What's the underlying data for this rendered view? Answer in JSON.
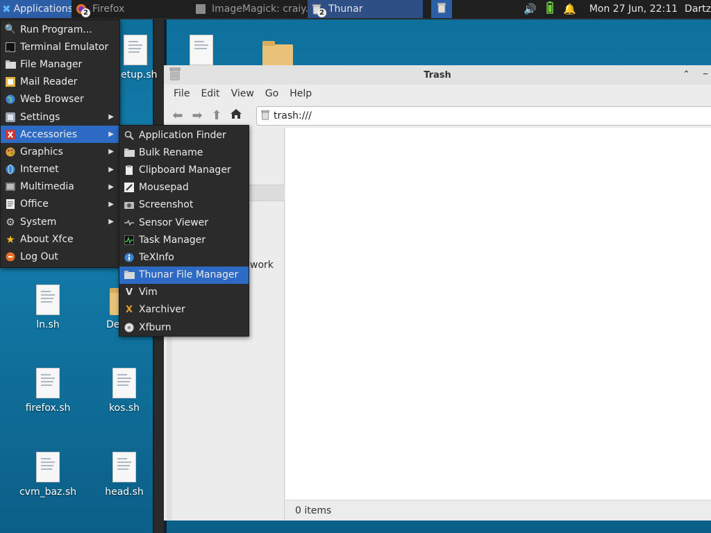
{
  "panel": {
    "applications_label": "Applications",
    "tasks": [
      {
        "label": "Firefox",
        "badge": "2"
      },
      {
        "label": "ImageMagick: craiy..."
      },
      {
        "label": "Thunar",
        "badge": "2"
      }
    ],
    "clock": "Mon 27 Jun, 22:11",
    "user": "Dartz"
  },
  "desktop": {
    "icons": [
      {
        "label": "etup.sh"
      },
      {
        "label": "ln.sh"
      },
      {
        "label": "De"
      },
      {
        "label": "firefox.sh"
      },
      {
        "label": "kos.sh"
      },
      {
        "label": "cvm_baz.sh"
      },
      {
        "label": "head.sh"
      }
    ]
  },
  "thunar": {
    "title": "Trash",
    "menu": [
      "File",
      "Edit",
      "View",
      "Go",
      "Help"
    ],
    "location": "trash:///",
    "side_label": "work",
    "status": "0 items"
  },
  "app_menu": {
    "items": [
      {
        "label": "Run Program...",
        "icon": "run-icon"
      },
      {
        "label": "Terminal Emulator",
        "icon": "terminal-icon"
      },
      {
        "label": "File Manager",
        "icon": "folder-icon"
      },
      {
        "label": "Mail Reader",
        "icon": "mail-icon"
      },
      {
        "label": "Web Browser",
        "icon": "globe-icon"
      },
      {
        "label": "Settings",
        "icon": "settings-icon",
        "submenu": true
      },
      {
        "label": "Accessories",
        "icon": "accessories-icon",
        "submenu": true,
        "active": true
      },
      {
        "label": "Graphics",
        "icon": "graphics-icon",
        "submenu": true
      },
      {
        "label": "Internet",
        "icon": "internet-icon",
        "submenu": true
      },
      {
        "label": "Multimedia",
        "icon": "multimedia-icon",
        "submenu": true
      },
      {
        "label": "Office",
        "icon": "office-icon",
        "submenu": true
      },
      {
        "label": "System",
        "icon": "gear-icon",
        "submenu": true
      },
      {
        "label": "About Xfce",
        "icon": "star-icon"
      },
      {
        "label": "Log Out",
        "icon": "logout-icon"
      }
    ]
  },
  "accessories_menu": {
    "items": [
      {
        "label": "Application Finder",
        "icon": "search-icon"
      },
      {
        "label": "Bulk Rename",
        "icon": "folder-icon"
      },
      {
        "label": "Clipboard Manager",
        "icon": "clipboard-icon"
      },
      {
        "label": "Mousepad",
        "icon": "editor-icon"
      },
      {
        "label": "Screenshot",
        "icon": "camera-icon"
      },
      {
        "label": "Sensor Viewer",
        "icon": "sensor-icon"
      },
      {
        "label": "Task Manager",
        "icon": "task-manager-icon"
      },
      {
        "label": "TeXInfo",
        "icon": "info-icon"
      },
      {
        "label": "Thunar File Manager",
        "icon": "folder-icon",
        "active": true
      },
      {
        "label": "Vim",
        "icon": "vim-icon"
      },
      {
        "label": "Xarchiver",
        "icon": "archive-icon"
      },
      {
        "label": "Xfburn",
        "icon": "disc-icon"
      }
    ]
  }
}
